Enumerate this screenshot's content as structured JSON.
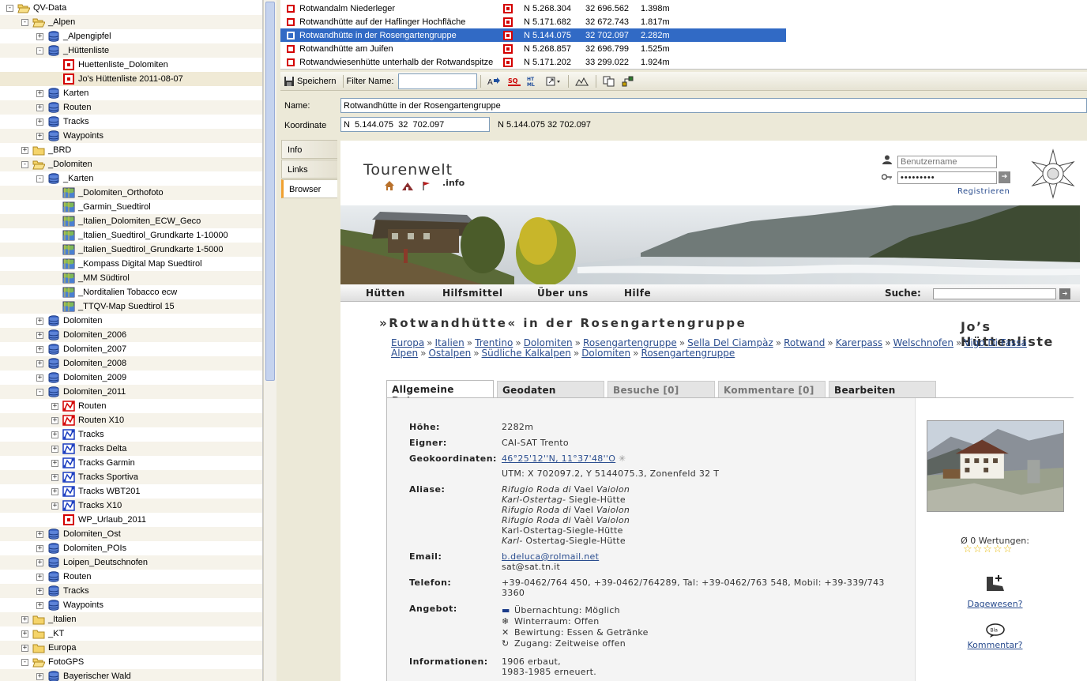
{
  "tree": {
    "items": [
      {
        "label": "QV-Data",
        "depth": 0,
        "twisty": "-",
        "icon": "folder-open"
      },
      {
        "label": "_Alpen",
        "depth": 1,
        "twisty": "-",
        "icon": "folder-open"
      },
      {
        "label": "_Alpengipfel",
        "depth": 2,
        "twisty": "+",
        "icon": "database"
      },
      {
        "label": "_Hüttenliste",
        "depth": 2,
        "twisty": "-",
        "icon": "database"
      },
      {
        "label": "Huettenliste_Dolomiten",
        "depth": 3,
        "twisty": "",
        "icon": "waypoint-list"
      },
      {
        "label": "Jo's Hüttenliste 2011-08-07",
        "depth": 3,
        "twisty": "",
        "icon": "waypoint-list",
        "selected": true
      },
      {
        "label": "Karten",
        "depth": 2,
        "twisty": "+",
        "icon": "database"
      },
      {
        "label": "Routen",
        "depth": 2,
        "twisty": "+",
        "icon": "database"
      },
      {
        "label": "Tracks",
        "depth": 2,
        "twisty": "+",
        "icon": "database"
      },
      {
        "label": "Waypoints",
        "depth": 2,
        "twisty": "+",
        "icon": "database"
      },
      {
        "label": "_BRD",
        "depth": 1,
        "twisty": "+",
        "icon": "folder"
      },
      {
        "label": "_Dolomiten",
        "depth": 1,
        "twisty": "-",
        "icon": "folder-open"
      },
      {
        "label": "_Karten",
        "depth": 2,
        "twisty": "-",
        "icon": "database"
      },
      {
        "label": "_Dolomiten_Orthofoto",
        "depth": 3,
        "twisty": "",
        "icon": "map"
      },
      {
        "label": "_Garmin_Suedtirol",
        "depth": 3,
        "twisty": "",
        "icon": "map"
      },
      {
        "label": "_Italien_Dolomiten_ECW_Geco",
        "depth": 3,
        "twisty": "",
        "icon": "map"
      },
      {
        "label": "_Italien_Suedtirol_Grundkarte 1-10000",
        "depth": 3,
        "twisty": "",
        "icon": "map"
      },
      {
        "label": "_Italien_Suedtirol_Grundkarte 1-5000",
        "depth": 3,
        "twisty": "",
        "icon": "map"
      },
      {
        "label": "_Kompass Digital Map Suedtirol",
        "depth": 3,
        "twisty": "",
        "icon": "map"
      },
      {
        "label": "_MM Südtirol",
        "depth": 3,
        "twisty": "",
        "icon": "map"
      },
      {
        "label": "_Norditalien Tobacco  ecw",
        "depth": 3,
        "twisty": "",
        "icon": "map"
      },
      {
        "label": "_TTQV-Map Suedtirol 15",
        "depth": 3,
        "twisty": "",
        "icon": "map"
      },
      {
        "label": "Dolomiten",
        "depth": 2,
        "twisty": "+",
        "icon": "database"
      },
      {
        "label": "Dolomiten_2006",
        "depth": 2,
        "twisty": "+",
        "icon": "database"
      },
      {
        "label": "Dolomiten_2007",
        "depth": 2,
        "twisty": "+",
        "icon": "database"
      },
      {
        "label": "Dolomiten_2008",
        "depth": 2,
        "twisty": "+",
        "icon": "database"
      },
      {
        "label": "Dolomiten_2009",
        "depth": 2,
        "twisty": "+",
        "icon": "database"
      },
      {
        "label": "Dolomiten_2011",
        "depth": 2,
        "twisty": "-",
        "icon": "database"
      },
      {
        "label": "Routen",
        "depth": 3,
        "twisty": "+",
        "icon": "route"
      },
      {
        "label": "Routen X10",
        "depth": 3,
        "twisty": "+",
        "icon": "route"
      },
      {
        "label": "Tracks",
        "depth": 3,
        "twisty": "+",
        "icon": "track"
      },
      {
        "label": "Tracks Delta",
        "depth": 3,
        "twisty": "+",
        "icon": "track"
      },
      {
        "label": "Tracks Garmin",
        "depth": 3,
        "twisty": "+",
        "icon": "track"
      },
      {
        "label": "Tracks Sportiva",
        "depth": 3,
        "twisty": "+",
        "icon": "track"
      },
      {
        "label": "Tracks WBT201",
        "depth": 3,
        "twisty": "+",
        "icon": "track"
      },
      {
        "label": "Tracks X10",
        "depth": 3,
        "twisty": "+",
        "icon": "track"
      },
      {
        "label": "WP_Urlaub_2011",
        "depth": 3,
        "twisty": "",
        "icon": "waypoint-list"
      },
      {
        "label": "Dolomiten_Ost",
        "depth": 2,
        "twisty": "+",
        "icon": "database"
      },
      {
        "label": "Dolomiten_POIs",
        "depth": 2,
        "twisty": "+",
        "icon": "database"
      },
      {
        "label": "Loipen_Deutschnofen",
        "depth": 2,
        "twisty": "+",
        "icon": "database"
      },
      {
        "label": "Routen",
        "depth": 2,
        "twisty": "+",
        "icon": "database"
      },
      {
        "label": "Tracks",
        "depth": 2,
        "twisty": "+",
        "icon": "database"
      },
      {
        "label": "Waypoints",
        "depth": 2,
        "twisty": "+",
        "icon": "database"
      },
      {
        "label": "_Italien",
        "depth": 1,
        "twisty": "+",
        "icon": "folder"
      },
      {
        "label": "_KT",
        "depth": 1,
        "twisty": "+",
        "icon": "folder"
      },
      {
        "label": "Europa",
        "depth": 1,
        "twisty": "+",
        "icon": "folder"
      },
      {
        "label": "FotoGPS",
        "depth": 1,
        "twisty": "-",
        "icon": "folder-open"
      },
      {
        "label": "Bayerischer Wald",
        "depth": 2,
        "twisty": "+",
        "icon": "database"
      }
    ]
  },
  "list": {
    "rows": [
      {
        "name": "Rotwandalm Niederleger",
        "north": "N  5.268.304",
        "east": "32  696.562",
        "elev": "1.398m"
      },
      {
        "name": "Rotwandhütte auf der Haflinger Hochfläche",
        "north": "N  5.171.682",
        "east": "32  672.743",
        "elev": "1.817m"
      },
      {
        "name": "Rotwandhütte in der Rosengartengruppe",
        "north": "N  5.144.075",
        "east": "32  702.097",
        "elev": "2.282m",
        "selected": true
      },
      {
        "name": "Rotwandhütte am Juifen",
        "north": "N  5.268.857",
        "east": "32  696.799",
        "elev": "1.525m"
      },
      {
        "name": "Rotwandwiesenhütte unterhalb der Rotwandspitze",
        "north": "N  5.171.202",
        "east": "33  299.022",
        "elev": "1.924m"
      }
    ]
  },
  "toolbar": {
    "save_label": "Speichern",
    "filter_label": "Filter Name:",
    "filter_value": ""
  },
  "form": {
    "name_label": "Name:",
    "name_value": "Rotwandhütte in der Rosengartengruppe",
    "coord_label": "Koordinate",
    "coord_value": "N  5.144.075  32  702.097",
    "coord_display": "N  5.144.075  32  702.097"
  },
  "side_tabs": {
    "info": "Info",
    "links": "Links",
    "browser": "Browser"
  },
  "web": {
    "logo": "Tourenwelt",
    "logo_suffix": ".info",
    "username_placeholder": "Benutzername",
    "password_dots": "•••••••••",
    "register": "Registrieren",
    "nav": [
      "Hütten",
      "Hilfsmittel",
      "Über uns",
      "Hilfe"
    ],
    "search_label": "Suche:",
    "title": "»Rotwandhütte« in der Rosengartengruppe",
    "brand_right": "Jo’s Hüttenliste",
    "crumbs_line1": [
      "Europa",
      "Italien",
      "Trentino",
      "Dolomiten",
      "Rosengartengruppe",
      "Sella Del Ciampàz",
      "Rotwand",
      "Karerpass",
      "Welschnofen",
      "Vigo Di Fassa"
    ],
    "crumbs_line2": [
      "Alpen",
      "Ostalpen",
      "Südliche Kalkalpen",
      "Dolomiten",
      "Rosengartengruppe"
    ],
    "tabs": [
      "Allgemeine Daten",
      "Geodaten",
      "Besuche [0]",
      "Kommentare [0]",
      "Bearbeiten"
    ],
    "info": {
      "hoehe_label": "Höhe:",
      "hoehe": "2282m",
      "eigner_label": "Eigner:",
      "eigner": "CAI-SAT Trento",
      "geo_label": "Geokoordinaten:",
      "geo": "46°25'12''N, 11°37'48''O",
      "utm": "UTM: X 702097.2, Y 5144075.3, Zonenfeld 32 T",
      "aliase_label": "Aliase:",
      "aliase": [
        [
          "Rifugio Roda di",
          " Vael ",
          "Vaiolon"
        ],
        [
          "Karl-Ostertag-",
          " Siegle-Hütte",
          ""
        ],
        [
          "Rifugio Roda di",
          " Vael ",
          "Vaiolon"
        ],
        [
          "Rifugio Roda di",
          " Vaèl ",
          "Vaiolon"
        ],
        [
          "",
          "Karl-Ostertag-Siegle-Hütte",
          ""
        ],
        [
          "Karl-",
          " Ostertag-Siegle-Hütte",
          ""
        ]
      ],
      "email_label": "Email:",
      "email1": "b.deluca@rolmail.net",
      "email2": "sat@sat.tn.it",
      "telefon_label": "Telefon:",
      "telefon_1": "+39-0462/764 450, +39-0462/764289, Tal: +39-0462/763 548, Mobil: +39-339/743",
      "telefon_2": "3360",
      "angebot_label": "Angebot:",
      "angebot": [
        "Übernachtung: Möglich",
        "Winterraum: Offen",
        "Bewirtung: Essen & Getränke",
        "Zugang: Zeitweise offen"
      ],
      "informationen_label": "Informationen:",
      "informationen": [
        "1906 erbaut,",
        "1983-1985 erneuert."
      ]
    },
    "ratings_label": "Ø 0 Wertungen:",
    "stars": "☆☆☆☆☆",
    "dagewesen": "Dagewesen?",
    "kommentar": "Kommentar?",
    "bla": "Bla"
  }
}
